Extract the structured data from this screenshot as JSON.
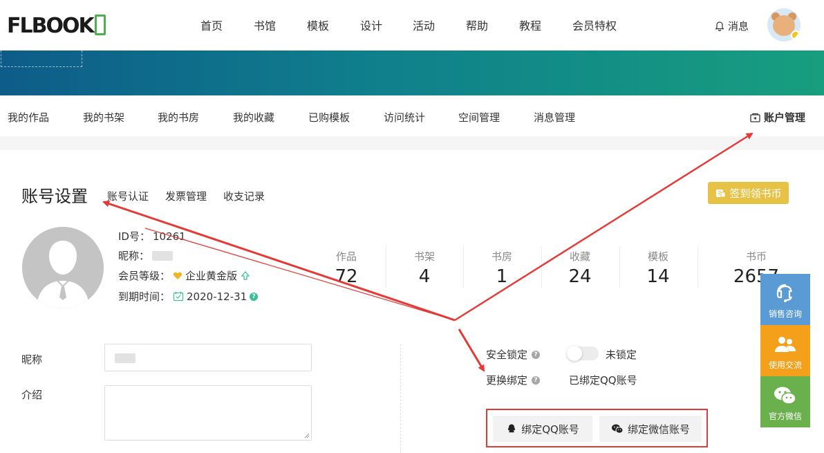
{
  "header": {
    "logo_text": "FLBOOK",
    "nav": [
      "首页",
      "书馆",
      "模板",
      "设计",
      "活动",
      "帮助",
      "教程",
      "会员特权"
    ],
    "messages_label": "消息"
  },
  "subnav": {
    "items": [
      "我的作品",
      "我的书架",
      "我的书房",
      "我的收藏",
      "已购模板",
      "访问统计",
      "空间管理",
      "消息管理"
    ],
    "account_label": "账户管理"
  },
  "account": {
    "title": "账号设置",
    "links": [
      "账号认证",
      "发票管理",
      "收支记录"
    ],
    "checkin_label": "签到领书币",
    "id_label": "ID号：",
    "id_value": "10261",
    "nickname_label": "昵称：",
    "level_label": "会员等级：",
    "level_value": "企业黄金版",
    "expire_label": "到期时间：",
    "expire_value": "2020-12-31"
  },
  "stats": [
    {
      "label": "作品",
      "value": "72"
    },
    {
      "label": "书架",
      "value": "4"
    },
    {
      "label": "书房",
      "value": "1"
    },
    {
      "label": "收藏",
      "value": "24"
    },
    {
      "label": "模板",
      "value": "14"
    },
    {
      "label": "书币",
      "value": "2657"
    }
  ],
  "form": {
    "nickname_label": "昵称",
    "intro_label": "介绍"
  },
  "security": {
    "lock_label": "安全锁定",
    "lock_status": "未锁定",
    "bind_label": "更换绑定",
    "bind_status": "已绑定QQ账号",
    "bind_qq_label": "绑定QQ账号",
    "bind_wechat_label": "绑定微信账号"
  },
  "side_panel": [
    {
      "label": "销售咨询",
      "color": "#5b9bd5"
    },
    {
      "label": "使用交流",
      "color": "#f5a01a"
    },
    {
      "label": "官方微信",
      "color": "#6ab04c"
    }
  ],
  "colors": {
    "accent_gold": "#e6c347",
    "annotation_red": "#e53935"
  }
}
